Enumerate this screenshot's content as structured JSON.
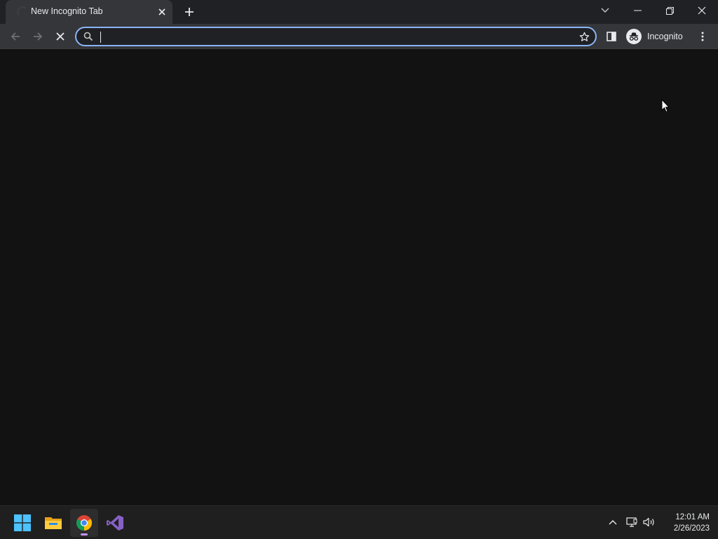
{
  "tab": {
    "title": "New Incognito Tab"
  },
  "omnibox": {
    "value": "",
    "placeholder": ""
  },
  "profile": {
    "label": "Incognito"
  },
  "clock": {
    "time": "12:01 AM",
    "date": "2/26/2023"
  },
  "icons": {
    "tab_spinner": "loading-spinner-icon",
    "tab_close": "close-icon",
    "new_tab": "plus-icon",
    "tab_search": "chevron-down-icon",
    "back": "arrow-left-icon",
    "forward": "arrow-right-icon",
    "stop": "stop-x-icon",
    "search": "search-icon",
    "bookmark": "star-icon",
    "side_panel": "side-panel-icon",
    "incognito": "incognito-icon",
    "menu": "kebab-menu-icon"
  },
  "colors": {
    "accent": "#8ab4f8",
    "frame": "#202124",
    "toolbar": "#35363a",
    "content": "#121212",
    "taskbar": "#1f1f1f"
  },
  "taskbar": {
    "apps": [
      "Start",
      "File Explorer",
      "Google Chrome",
      "Visual Studio"
    ]
  }
}
